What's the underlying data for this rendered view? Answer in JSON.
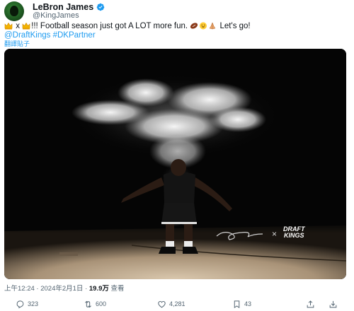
{
  "author": {
    "display_name": "LeBron James",
    "handle": "@KingJames",
    "verified_icon": "verified-badge-icon",
    "avatar_icon": "profile-avatar"
  },
  "tweet": {
    "line1_mid": " x ",
    "line1_text": "!!! Football season just got A LOT more fun. ",
    "line1_end": " Let's go!",
    "emojis": [
      "crown-emoji",
      "crown-emoji",
      "football-emoji",
      "grinning-emoji",
      "praying-hands-emoji"
    ],
    "mention": "@DraftKings",
    "hashtag": "#DKPartner",
    "translate_label": "翻譯貼子"
  },
  "media": {
    "brand_mark_text": "DRAFT\nKINGS",
    "brand_line1": "DRAFT",
    "brand_line2": "KINGS",
    "separator": "×"
  },
  "meta": {
    "time": "上午12:24",
    "separator": "·",
    "date": "2024年2月1日",
    "views_count": "19.9万",
    "views_label": "查看"
  },
  "actions": {
    "reply_count": "323",
    "repost_count": "600",
    "like_count": "4,281",
    "bookmark_count": "43"
  },
  "colors": {
    "accent": "#1d9bf0",
    "text_primary": "#0f1419",
    "text_secondary": "#536471",
    "media_bg": "#050505"
  }
}
